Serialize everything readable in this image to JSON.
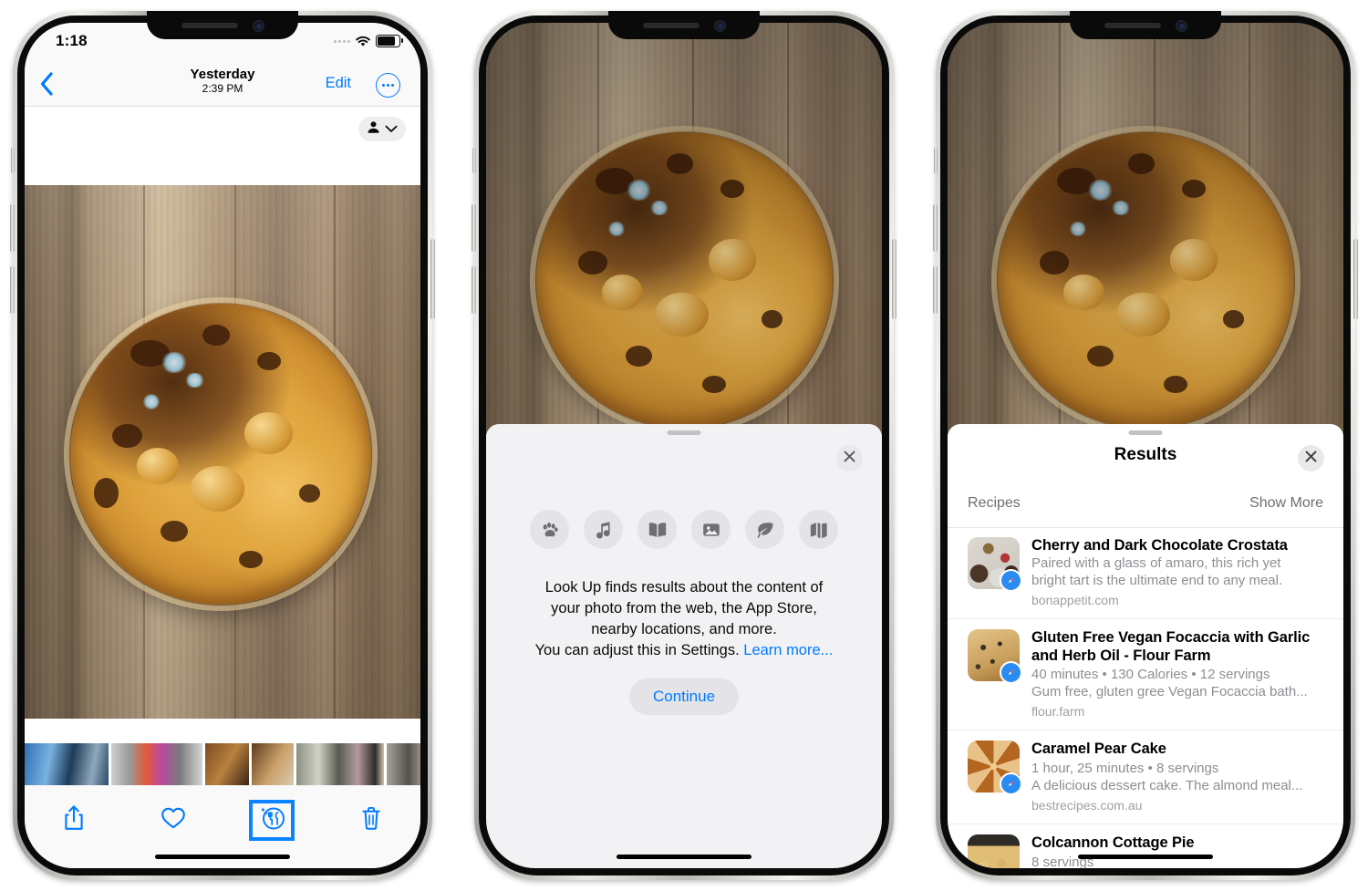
{
  "phone1": {
    "status_bar": {
      "time": "1:18",
      "wifi_icon": "wifi-icon",
      "battery_icon": "battery-icon"
    },
    "nav": {
      "back_icon": "chevron-left-icon",
      "title": "Yesterday",
      "subtitle": "2:39 PM",
      "edit_label": "Edit",
      "more_icon": "ellipsis-circle-icon"
    },
    "people_pill": {
      "person_icon": "person-icon",
      "chevron_icon": "chevron-down-icon"
    },
    "toolbar": {
      "share_icon": "share-icon",
      "favorite_icon": "heart-icon",
      "lookup_icon": "lookup-food-icon",
      "delete_icon": "trash-icon"
    }
  },
  "phone2": {
    "sheet": {
      "grabber": "grabber-handle",
      "close_icon": "close-icon",
      "icons": [
        {
          "name": "paw-print-icon",
          "glyph": "paw"
        },
        {
          "name": "music-note-icon",
          "glyph": "music"
        },
        {
          "name": "open-book-icon",
          "glyph": "book"
        },
        {
          "name": "landmark-photo-icon",
          "glyph": "photo"
        },
        {
          "name": "leaf-icon",
          "glyph": "leaf"
        },
        {
          "name": "folded-map-icon",
          "glyph": "map"
        }
      ],
      "body_line1": "Look Up finds results about the content of",
      "body_line2": "your photo from the web, the App Store,",
      "body_line3": "nearby locations, and more.",
      "body_line4": "You can adjust this in Settings.",
      "learn_more": "Learn more...",
      "continue_label": "Continue"
    }
  },
  "phone3": {
    "sheet": {
      "title": "Results",
      "close_icon": "close-icon",
      "section_label": "Recipes",
      "show_more_label": "Show More",
      "results": [
        {
          "thumb": "art-crostata",
          "badge_icon": "safari-compass-icon",
          "heading": "Cherry and Dark Chocolate Crostata",
          "meta": "",
          "description_line1": "Paired with a glass of amaro, this rich yet",
          "description_line2": "bright tart is the ultimate end to any meal.",
          "url": "bonappetit.com"
        },
        {
          "thumb": "art-focaccia",
          "badge_icon": "safari-compass-icon",
          "heading": "Gluten Free Vegan Focaccia with Garlic and Herb Oil - Flour Farm",
          "meta": "40 minutes • 130 Calories • 12 servings",
          "description_line1": "Gum free, gluten gree Vegan Focaccia bath...",
          "description_line2": "",
          "url": "flour.farm"
        },
        {
          "thumb": "art-pear",
          "badge_icon": "safari-compass-icon",
          "heading": "Caramel Pear Cake",
          "meta": "1 hour, 25 minutes • 8 servings",
          "description_line1": "A delicious dessert cake. The almond meal...",
          "description_line2": "",
          "url": "bestrecipes.com.au"
        },
        {
          "thumb": "art-colcannon",
          "badge_icon": "safari-compass-icon",
          "heading": "Colcannon Cottage Pie",
          "meta": "8 servings",
          "description_line1": "",
          "description_line2": "",
          "url": ""
        }
      ]
    }
  },
  "colors": {
    "accent_blue": "#007aff",
    "selection_blue": "#0a84ff",
    "sheet_gray": "#f2f2f4",
    "secondary_text": "#8e8e93"
  }
}
